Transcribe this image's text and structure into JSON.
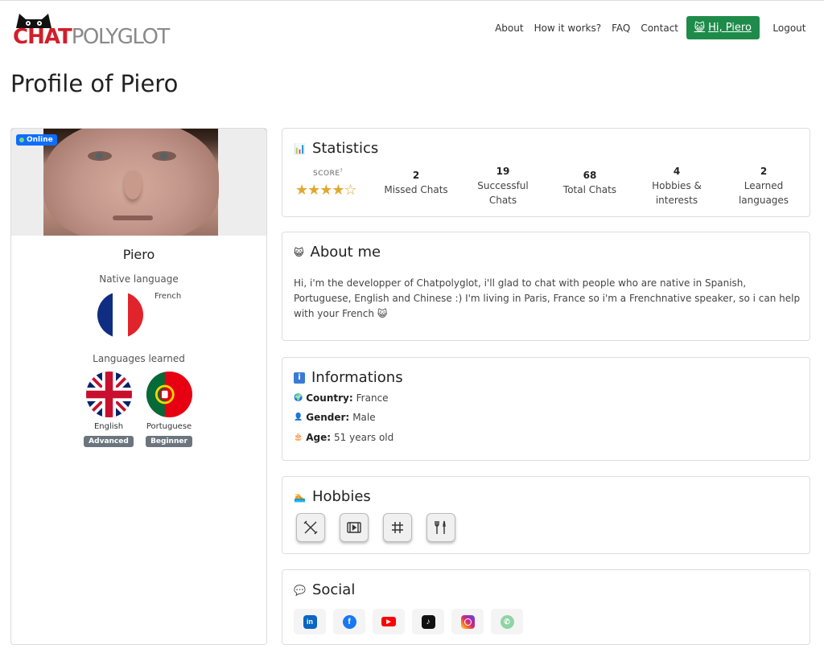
{
  "brand": {
    "part1": "CHAT",
    "part2": "POLYGLOT"
  },
  "nav": {
    "about": "About",
    "how": "How it works?",
    "faq": "FAQ",
    "contact": "Contact",
    "greeting": "Hi, Piero",
    "logout": "Logout"
  },
  "page_title": "Profile of Piero",
  "profile": {
    "status": "Online",
    "name": "Piero",
    "native_label": "Native language",
    "native_language": "French",
    "learned_label": "Languages learned",
    "learned": [
      {
        "name": "English",
        "level": "Advanced"
      },
      {
        "name": "Portuguese",
        "level": "Beginner"
      }
    ]
  },
  "statistics": {
    "title": "Statistics",
    "score_label": "SCORE",
    "score_sup": "?",
    "score_stars": 4,
    "score_stars_text": "★★★★☆",
    "items": [
      {
        "value": "2",
        "label": "Missed Chats"
      },
      {
        "value": "19",
        "label": "Successful Chats"
      },
      {
        "value": "68",
        "label": "Total Chats"
      },
      {
        "value": "4",
        "label": "Hobbies & interests"
      },
      {
        "value": "2",
        "label": "Learned languages"
      }
    ]
  },
  "about": {
    "title": "About me",
    "text": "Hi, i'm the developper of Chatpolyglot, i'll glad to chat with people who are native in Spanish, Portuguese, English and Chinese :) I'm living in Paris, France so i'm a Frenchnative speaker, so i can help with your French 😺"
  },
  "informations": {
    "title": "Informations",
    "country_label": "Country:",
    "country": "France",
    "gender_label": "Gender:",
    "gender": "Male",
    "age_label": "Age:",
    "age": "51 years old"
  },
  "hobbies": {
    "title": "Hobbies",
    "icons": [
      "tools-icon",
      "film-icon",
      "hashtag-icon",
      "wrench-screwdriver-icon"
    ]
  },
  "social": {
    "title": "Social",
    "icons": [
      "linkedin-icon",
      "facebook-icon",
      "youtube-icon",
      "tiktok-icon",
      "instagram-icon",
      "whatsapp-icon"
    ]
  },
  "colors": {
    "brand_red": "#d11f2a",
    "greeting_green": "#1e8b4a",
    "online_blue": "#0d6efd",
    "star": "#e0a82e"
  }
}
